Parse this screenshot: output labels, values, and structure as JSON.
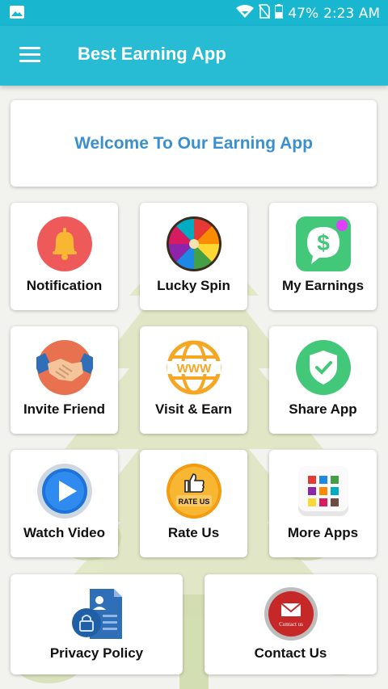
{
  "status_bar": {
    "battery": "47%",
    "time": "2:23 AM"
  },
  "app_bar": {
    "title": "Best Earning App"
  },
  "welcome": {
    "text": "Welcome To Our Earning App"
  },
  "tiles": {
    "notification": "Notification",
    "lucky_spin": "Lucky Spin",
    "my_earnings": "My Earnings",
    "invite_friend": "Invite Friend",
    "visit_earn": "Visit & Earn",
    "share_app": "Share App",
    "watch_video": "Watch Video",
    "rate_us": "Rate Us",
    "more_apps": "More Apps",
    "privacy_policy": "Privacy Policy",
    "contact_us": "Contact Us"
  },
  "icon_text": {
    "www": "WWW",
    "rate_badge": "RATE US",
    "dollar": "$",
    "contact_badge": "Contact us"
  },
  "colors": {
    "primary": "#27bcd4",
    "status": "#19b6cf",
    "accent": "#3a8fcf"
  }
}
